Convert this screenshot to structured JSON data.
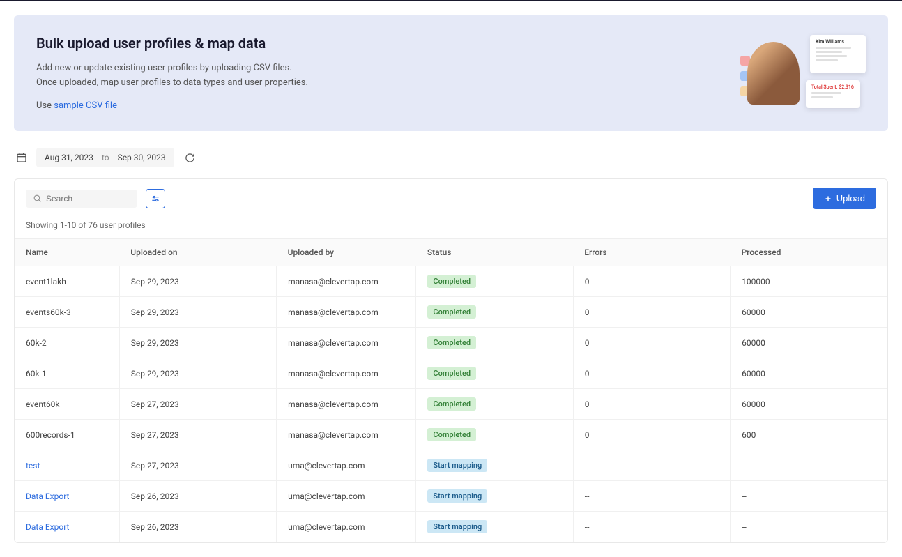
{
  "hero": {
    "title": "Bulk upload user profiles & map data",
    "desc_line1": "Add new or update existing user profiles by uploading CSV files.",
    "desc_line2": "Once uploaded, map user profiles to data types and user properties.",
    "link_prefix": "Use ",
    "link_text": "sample CSV file",
    "card_name": "Kim Williams",
    "card_amount": "Total Spent: $2,316"
  },
  "daterange": {
    "from": "Aug 31, 2023",
    "to_label": "to",
    "to": "Sep 30, 2023"
  },
  "search": {
    "placeholder": "Search"
  },
  "upload_label": "Upload",
  "showing": "Showing 1-10 of 76 user profiles",
  "columns": {
    "name": "Name",
    "uploaded_on": "Uploaded on",
    "uploaded_by": "Uploaded by",
    "status": "Status",
    "errors": "Errors",
    "processed": "Processed"
  },
  "status_labels": {
    "completed": "Completed",
    "mapping": "Start mapping"
  },
  "rows": [
    {
      "name": "event1lakh",
      "link": false,
      "uploaded_on": "Sep 29, 2023",
      "uploaded_by": "manasa@clevertap.com",
      "status": "completed",
      "errors": "0",
      "processed": "100000"
    },
    {
      "name": "events60k-3",
      "link": false,
      "uploaded_on": "Sep 29, 2023",
      "uploaded_by": "manasa@clevertap.com",
      "status": "completed",
      "errors": "0",
      "processed": "60000"
    },
    {
      "name": "60k-2",
      "link": false,
      "uploaded_on": "Sep 29, 2023",
      "uploaded_by": "manasa@clevertap.com",
      "status": "completed",
      "errors": "0",
      "processed": "60000"
    },
    {
      "name": "60k-1",
      "link": false,
      "uploaded_on": "Sep 29, 2023",
      "uploaded_by": "manasa@clevertap.com",
      "status": "completed",
      "errors": "0",
      "processed": "60000"
    },
    {
      "name": "event60k",
      "link": false,
      "uploaded_on": "Sep 27, 2023",
      "uploaded_by": "manasa@clevertap.com",
      "status": "completed",
      "errors": "0",
      "processed": "60000"
    },
    {
      "name": "600records-1",
      "link": false,
      "uploaded_on": "Sep 27, 2023",
      "uploaded_by": "manasa@clevertap.com",
      "status": "completed",
      "errors": "0",
      "processed": "600"
    },
    {
      "name": "test",
      "link": true,
      "uploaded_on": "Sep 27, 2023",
      "uploaded_by": "uma@clevertap.com",
      "status": "mapping",
      "errors": "--",
      "processed": "--"
    },
    {
      "name": "Data Export",
      "link": true,
      "uploaded_on": "Sep 26, 2023",
      "uploaded_by": "uma@clevertap.com",
      "status": "mapping",
      "errors": "--",
      "processed": "--"
    },
    {
      "name": "Data Export",
      "link": true,
      "uploaded_on": "Sep 26, 2023",
      "uploaded_by": "uma@clevertap.com",
      "status": "mapping",
      "errors": "--",
      "processed": "--"
    }
  ]
}
